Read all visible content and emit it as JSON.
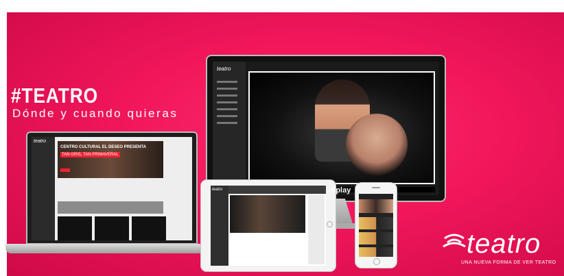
{
  "headline": "#TEATRO",
  "tagline": "Dónde y cuando quieras",
  "brand": {
    "name": "teatro",
    "slogan": "UNA NUEVA FORMA DE VER TEATRO"
  },
  "monitor": {
    "logo": "teatro",
    "player_brand": "Splay"
  },
  "laptop": {
    "logo": "teatro",
    "hero_title": "CENTRO CULTURAL EL DESEO PRESENTA",
    "hero_subtitle": "TAN GRIS, TAN PRIMAVERAL"
  },
  "tablet": {
    "logo": "teatro"
  },
  "colors": {
    "background": "#f0165a",
    "accent": "#e22233"
  }
}
